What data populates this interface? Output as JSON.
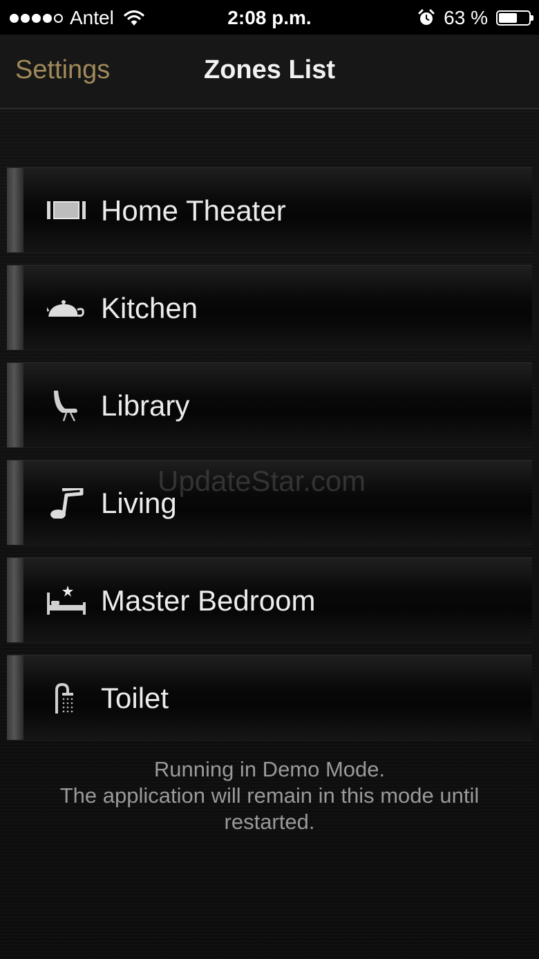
{
  "status_bar": {
    "carrier": "Antel",
    "time": "2:08 p.m.",
    "battery_text": "63 %",
    "battery_level": 0.63,
    "signal_bars_filled": 4,
    "signal_bars_total": 5,
    "icons": [
      "wifi-icon",
      "alarm-icon",
      "battery-icon"
    ]
  },
  "nav": {
    "back_label": "Settings",
    "title": "Zones List"
  },
  "zones": [
    {
      "label": "Home Theater",
      "icon": "screen-icon"
    },
    {
      "label": "Kitchen",
      "icon": "teapot-icon"
    },
    {
      "label": "Library",
      "icon": "chair-icon"
    },
    {
      "label": "Living",
      "icon": "music-note-icon"
    },
    {
      "label": "Master Bedroom",
      "icon": "bed-icon"
    },
    {
      "label": "Toilet",
      "icon": "shower-icon"
    }
  ],
  "watermark": "UpdateStar.com",
  "demo_note": {
    "line1": "Running in Demo Mode.",
    "line2": "The application will remain in this mode until",
    "line3": "restarted."
  },
  "colors": {
    "accent": "#a08a5a",
    "background": "#0c0c0c",
    "text": "#ececec",
    "muted_text": "#9a9a9a"
  }
}
